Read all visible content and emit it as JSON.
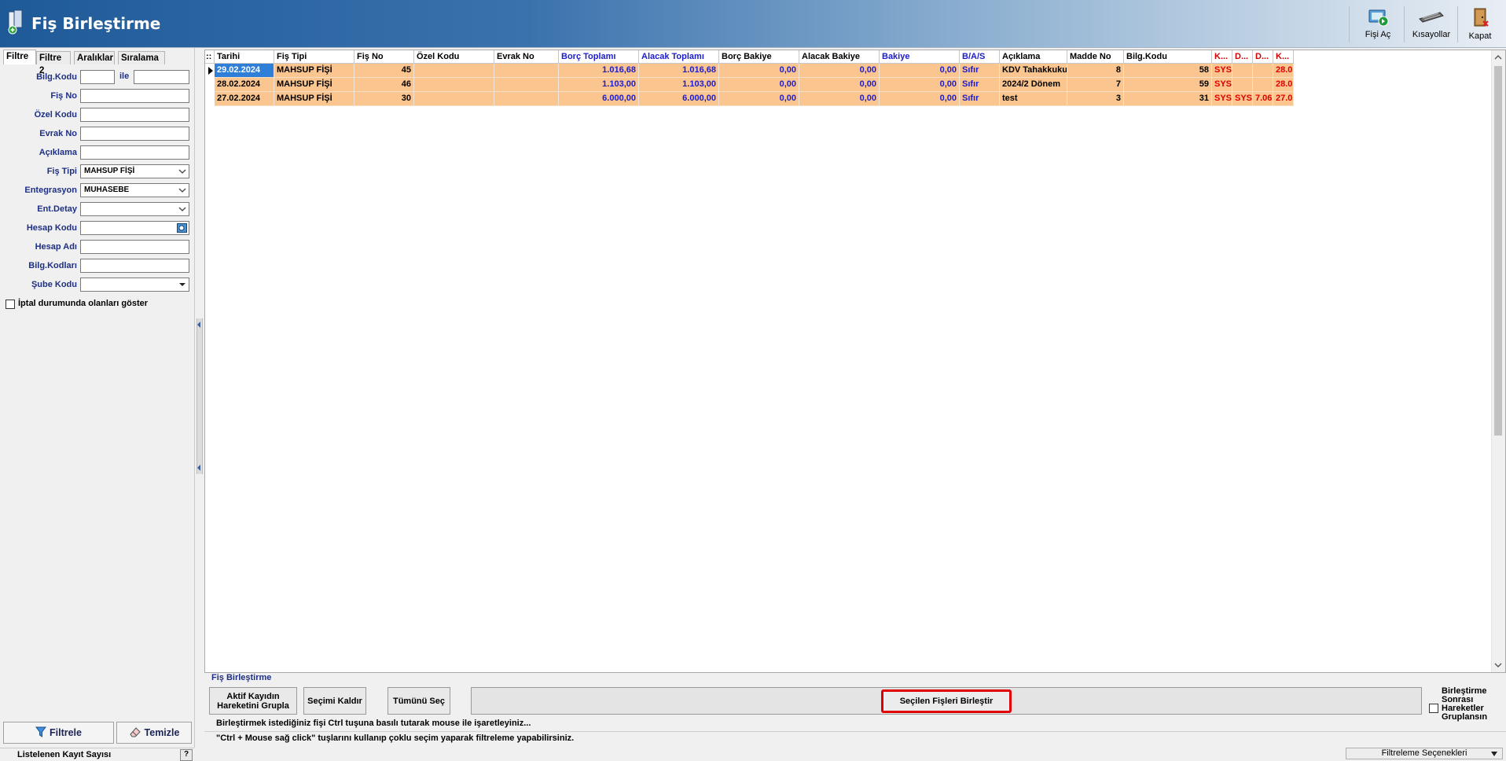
{
  "window": {
    "title": "Fiş Birleştirme"
  },
  "toolbar": {
    "open_label": "Fişi Aç",
    "shortcuts_label": "Kısayollar",
    "close_label": "Kapat"
  },
  "filter_tabs": [
    "Filtre",
    "Filtre 2",
    "Aralıklar",
    "Sıralama"
  ],
  "filter_form": {
    "bilg_kodu_label": "Bilg.Kodu",
    "ile_label": "ile",
    "fis_no_label": "Fiş No",
    "ozel_kodu_label": "Özel Kodu",
    "evrak_no_label": "Evrak No",
    "aciklama_label": "Açıklama",
    "fis_tipi_label": "Fiş Tipi",
    "fis_tipi_value": "MAHSUP FİŞİ",
    "entegrasyon_label": "Entegrasyon",
    "entegrasyon_value": "MUHASEBE",
    "ent_detay_label": "Ent.Detay",
    "hesap_kodu_label": "Hesap Kodu",
    "hesap_adi_label": "Hesap Adı",
    "bilg_kodlari_label": "Bilg.Kodları",
    "sube_kodu_label": "Şube Kodu",
    "iptal_label": "İptal durumunda olanları göster"
  },
  "left_buttons": {
    "filtrele": "Filtrele",
    "temizle": "Temizle"
  },
  "left_status": {
    "label": "Listelenen Kayıt Sayısı",
    "help": "?"
  },
  "grid": {
    "corner": "::",
    "columns": [
      {
        "key": "tarihi",
        "label": "Tarihi",
        "style": ""
      },
      {
        "key": "fis_tipi",
        "label": "Fiş Tipi",
        "style": ""
      },
      {
        "key": "fis_no",
        "label": "Fiş No",
        "style": ""
      },
      {
        "key": "ozel_kodu",
        "label": "Özel Kodu",
        "style": ""
      },
      {
        "key": "evrak_no",
        "label": "Evrak No",
        "style": ""
      },
      {
        "key": "borc_toplami",
        "label": "Borç Toplamı",
        "style": "blue"
      },
      {
        "key": "alacak_toplami",
        "label": "Alacak Toplamı",
        "style": "blue"
      },
      {
        "key": "borc_bakiye",
        "label": "Borç Bakiye",
        "style": ""
      },
      {
        "key": "alacak_bakiye",
        "label": "Alacak Bakiye",
        "style": ""
      },
      {
        "key": "bakiye",
        "label": "Bakiye",
        "style": "blue"
      },
      {
        "key": "bas",
        "label": "B/A/S",
        "style": "blue"
      },
      {
        "key": "aciklama",
        "label": "Açıklama",
        "style": ""
      },
      {
        "key": "madde_no",
        "label": "Madde No",
        "style": ""
      },
      {
        "key": "bilg_kodu",
        "label": "Bilg.Kodu",
        "style": ""
      },
      {
        "key": "k1",
        "label": "K...",
        "style": "red"
      },
      {
        "key": "d1",
        "label": "D...",
        "style": "red"
      },
      {
        "key": "d2",
        "label": "D...",
        "style": "red"
      },
      {
        "key": "k2",
        "label": "K...",
        "style": "red"
      }
    ],
    "rows": [
      {
        "tarihi": "29.02.2024",
        "fis_tipi": "MAHSUP FİŞİ",
        "fis_no": "45",
        "ozel_kodu": "",
        "evrak_no": "",
        "borc_toplami": "1.016,68",
        "alacak_toplami": "1.016,68",
        "borc_bakiye": "0,00",
        "alacak_bakiye": "0,00",
        "bakiye": "0,00",
        "bas": "Sıfır",
        "aciklama": "KDV Tahakkuku",
        "madde_no": "8",
        "bilg_kodu": "58",
        "k1": "SYS",
        "d1": "",
        "d2": "",
        "k2": "28.0"
      },
      {
        "tarihi": "28.02.2024",
        "fis_tipi": "MAHSUP FİŞİ",
        "fis_no": "46",
        "ozel_kodu": "",
        "evrak_no": "",
        "borc_toplami": "1.103,00",
        "alacak_toplami": "1.103,00",
        "borc_bakiye": "0,00",
        "alacak_bakiye": "0,00",
        "bakiye": "0,00",
        "bas": "Sıfır",
        "aciklama": "2024/2 Dönem",
        "madde_no": "7",
        "bilg_kodu": "59",
        "k1": "SYS",
        "d1": "",
        "d2": "",
        "k2": "28.0"
      },
      {
        "tarihi": "27.02.2024",
        "fis_tipi": "MAHSUP FİŞİ",
        "fis_no": "30",
        "ozel_kodu": "",
        "evrak_no": "",
        "borc_toplami": "6.000,00",
        "alacak_toplami": "6.000,00",
        "borc_bakiye": "0,00",
        "alacak_bakiye": "0,00",
        "bakiye": "0,00",
        "bas": "Sıfır",
        "aciklama": "test",
        "madde_no": "3",
        "bilg_kodu": "31",
        "k1": "SYS",
        "d1": "SYS",
        "d2": "7.06",
        "k2": "27.0"
      }
    ]
  },
  "bottom": {
    "section_title": "Fiş Birleştirme",
    "group_button": "Aktif Kayıdın Hareketini Grupla",
    "clear_selection_button": "Seçimi Kaldır",
    "select_all_button": "Tümünü Seç",
    "merge_button": "Seçilen Fişleri Birleştir",
    "group_after_merge_label": "Birleştirme Sonrası Hareketler Gruplansın",
    "hint1": "Birleştirmek istediğiniz fişi Ctrl tuşuna basılı tutarak mouse ile işaretleyiniz...",
    "hint2": "\"Ctrl + Mouse sağ click\" tuşlarını kullanıp çoklu seçim yaparak filtreleme yapabilirsiniz.",
    "filter_options": "Filtreleme Seçenekleri"
  },
  "colors": {
    "row_bg": "#fbc58f",
    "selected_cell": "#2f7ed8",
    "header_blue": "#1c1cd0",
    "header_red": "#d40000",
    "highlight_border": "#e00000"
  }
}
